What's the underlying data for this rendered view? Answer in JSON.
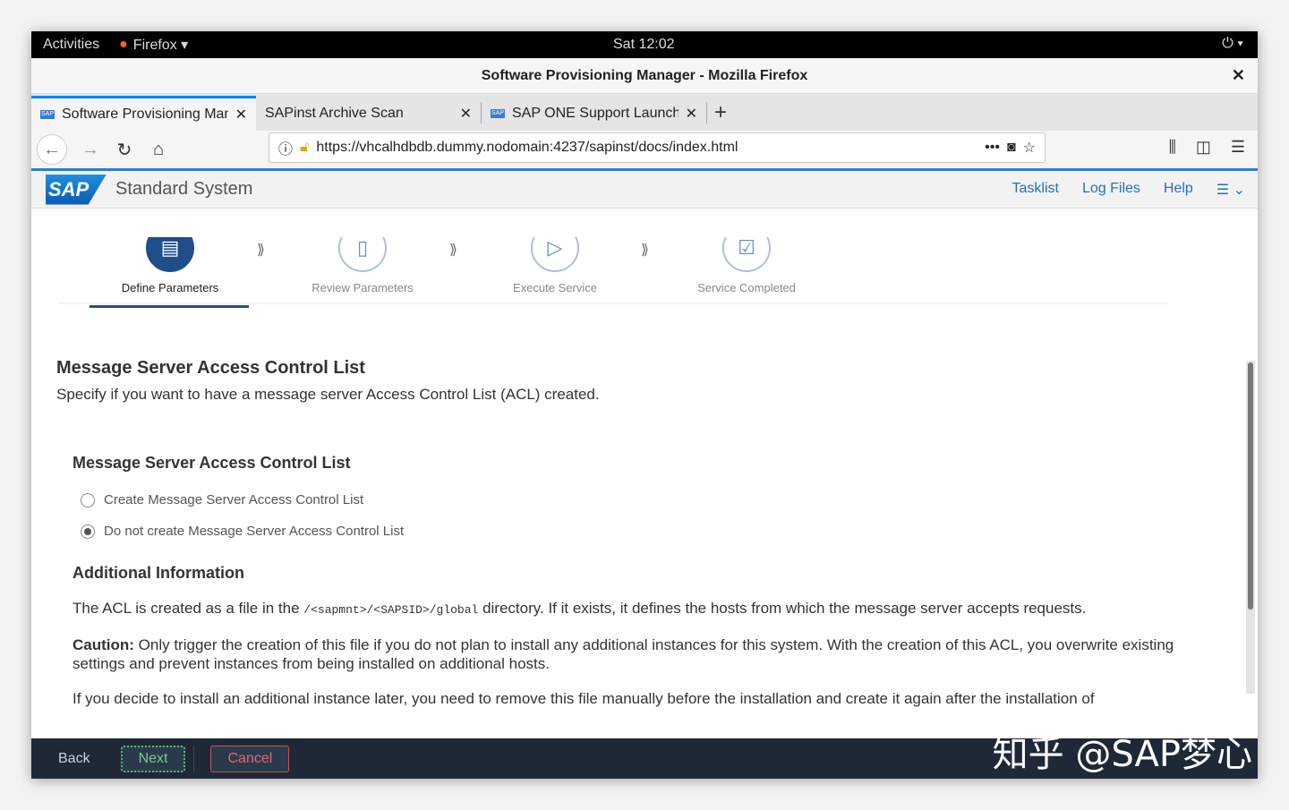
{
  "system_bar": {
    "activities": "Activities",
    "app": "Firefox ▾",
    "clock": "Sat 12:02",
    "power": "⏻ ▾"
  },
  "window_title": "Software Provisioning Manager - Mozilla Firefox",
  "tabs": [
    {
      "label": "Software Provisioning Manager",
      "active": true
    },
    {
      "label": "SAPinst Archive Scan"
    },
    {
      "label": "SAP ONE Support Launchpad"
    }
  ],
  "url": "https://vhcalhdbdb.dummy.nodomain:4237/sapinst/docs/index.html",
  "sap_header": {
    "logo": "SAP",
    "system": "Standard System",
    "links": [
      "Tasklist",
      "Log Files",
      "Help"
    ]
  },
  "steps": [
    {
      "label": "Define Parameters",
      "active": true
    },
    {
      "label": "Review Parameters"
    },
    {
      "label": "Execute Service"
    },
    {
      "label": "Service Completed"
    }
  ],
  "content": {
    "title": "Message Server Access Control List",
    "subtitle": "Specify if you want to have a message server Access Control List (ACL) created.",
    "group_title": "Message Server Access Control List",
    "options": [
      {
        "label": "Create Message Server Access Control List",
        "selected": false
      },
      {
        "label": "Do not create Message Server Access Control List",
        "selected": true
      }
    ],
    "info_title": "Additional Information",
    "p1_pre": "The ACL is created as a file in the ",
    "p1_code": "/<sapmnt>/<SAPSID>/global",
    "p1_post": " directory. If it exists, it defines the hosts from which the message server accepts requests.",
    "caution_label": "Caution:",
    "caution_text": " Only trigger the creation of this file if you do not plan to install any additional instances for this system. With the creation of this ACL, you overwrite existing settings and prevent instances from being installed on additional hosts.",
    "p3": "If you decide to install an additional instance later, you need to remove this file manually before the installation and create it again after the installation of"
  },
  "footer": {
    "back": "Back",
    "next": "Next",
    "cancel": "Cancel"
  },
  "watermark": "知乎 @SAP梦心"
}
